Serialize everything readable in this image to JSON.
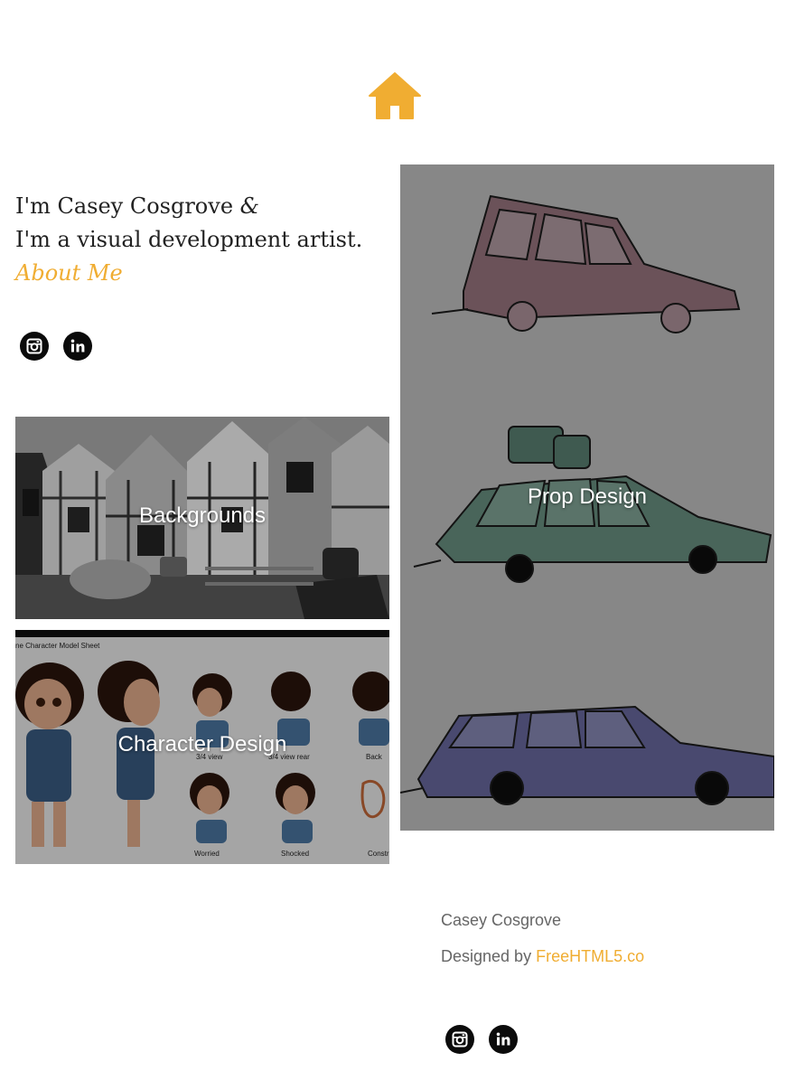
{
  "nav": {
    "home_icon": "home-icon",
    "accent_color": "#f0ad32"
  },
  "intro": {
    "line1": "I'm Casey Cosgrove",
    "ampersand": "&",
    "line2": "I'm a visual development artist.",
    "about_link": "About Me"
  },
  "social": {
    "icons": [
      "instagram-icon",
      "linkedin-icon"
    ]
  },
  "portfolio": {
    "backgrounds": "Backgrounds",
    "character_design": "Character Design",
    "prop_design": "Prop Design",
    "sheet": {
      "header": "ne Character Model Sheet",
      "labels": [
        "3/4 view",
        "3/4 view rear",
        "Back",
        "Worried",
        "Shocked",
        "Constr"
      ]
    }
  },
  "footer": {
    "name": "Casey Cosgrove",
    "designed_by": "Designed by ",
    "designer_link": "FreeHTML5.co"
  }
}
